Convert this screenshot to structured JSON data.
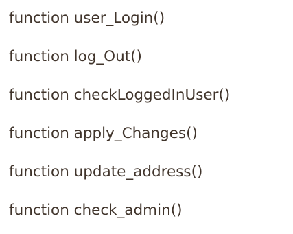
{
  "functions": [
    "function user_Login()",
    "function log_Out()",
    "function checkLoggedInUser()",
    "function apply_Changes()",
    "function update_address()",
    "function check_admin()"
  ]
}
